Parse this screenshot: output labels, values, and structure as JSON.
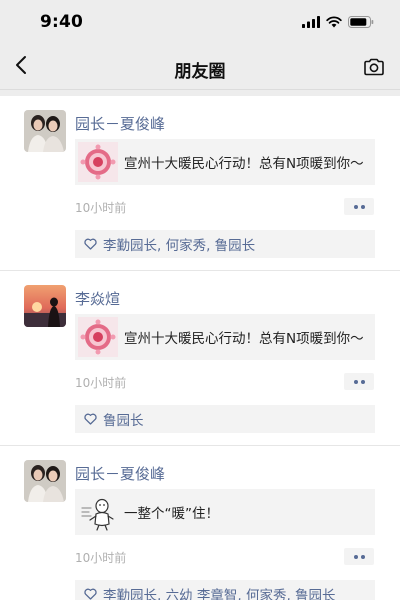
{
  "status_bar": {
    "time": "9:40"
  },
  "nav": {
    "title": "朋友圈",
    "back_icon": "chevron-left-icon",
    "camera_icon": "camera-icon"
  },
  "colors": {
    "link": "#576b95",
    "background": "#ededed",
    "card": "#f3f3f3",
    "muted": "#b0b0b0"
  },
  "posts": [
    {
      "author": "园长－夏俊峰",
      "share_text": "宣州十大暖民心行动！总有N项暖到你～",
      "time": "10小时前",
      "likes": "李勤园长, 何家秀, 鲁园长"
    },
    {
      "author": "李焱煊",
      "share_text": "宣州十大暖民心行动！总有N项暖到你～",
      "time": "10小时前",
      "likes": "鲁园长"
    },
    {
      "author": "园长－夏俊峰",
      "share_text": "一整个“暖”住！",
      "time": "10小时前",
      "likes": "李勤园长, 六幼 李章智, 何家秀, 鲁园长"
    }
  ]
}
